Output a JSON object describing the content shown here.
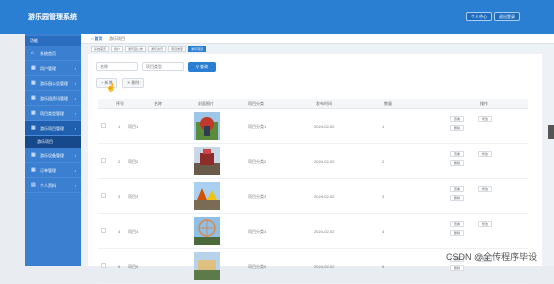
{
  "header": {
    "title": "游乐园管理系统",
    "user_label": "个人中心",
    "logout_label": "退出登录"
  },
  "sidebar": {
    "head": "功能",
    "items": [
      {
        "label": "系统首页",
        "icon": "home-icon",
        "glyph": "⌂"
      },
      {
        "label": "用户管理",
        "icon": "grid-icon",
        "glyph": "▦"
      },
      {
        "label": "游乐园公告管理",
        "icon": "grid-icon",
        "glyph": "▦"
      },
      {
        "label": "游乐园资讯管理",
        "icon": "grid-icon",
        "glyph": "▦"
      },
      {
        "label": "项目类型管理",
        "icon": "grid-icon",
        "glyph": "▦"
      },
      {
        "label": "游乐项目管理",
        "icon": "grid-icon",
        "glyph": "▦",
        "active": true
      }
    ],
    "sub_item": "游乐项目",
    "items_after": [
      {
        "label": "游乐设备管理",
        "icon": "grid-icon",
        "glyph": "▦"
      },
      {
        "label": "订单管理",
        "icon": "grid-icon",
        "glyph": "▦"
      },
      {
        "label": "个人资料",
        "icon": "document-icon",
        "glyph": "▤"
      }
    ]
  },
  "tabs": {
    "home": "首页",
    "current": "游乐项目"
  },
  "breadcrumbs": [
    "系统首页",
    "用户",
    "游乐园公告",
    "游乐资讯",
    "项目类型",
    "游乐项目"
  ],
  "search": {
    "name_placeholder": "名称",
    "type_placeholder": "项目类型",
    "button": "查询"
  },
  "actions": {
    "add": "新增",
    "delete": "删除"
  },
  "table": {
    "headers": [
      "序号",
      "名称",
      "封面图片",
      "项目分类",
      "发布时间",
      "数量",
      "操作"
    ],
    "rows": [
      {
        "index": "1",
        "name": "项目1",
        "type": "项目分类1",
        "date": "2024-02-02",
        "count": "1"
      },
      {
        "index": "2",
        "name": "项目2",
        "type": "项目分类2",
        "date": "2024-02-02",
        "count": "2"
      },
      {
        "index": "3",
        "name": "项目3",
        "type": "项目分类3",
        "date": "2024-02-02",
        "count": "3"
      },
      {
        "index": "4",
        "name": "项目4",
        "type": "项目分类4",
        "date": "2024-02-02",
        "count": "4"
      },
      {
        "index": "5",
        "name": "项目5",
        "type": "项目分类5",
        "date": "2024-02-02",
        "count": "5"
      }
    ],
    "op_view": "查看",
    "op_edit": "修改",
    "op_delete": "删除"
  },
  "colors": {
    "header": "#2b7fd3",
    "sidebar": "#3b7fd1",
    "accent": "#2b7fd3"
  },
  "watermark": "CSDN @全传程序毕设"
}
